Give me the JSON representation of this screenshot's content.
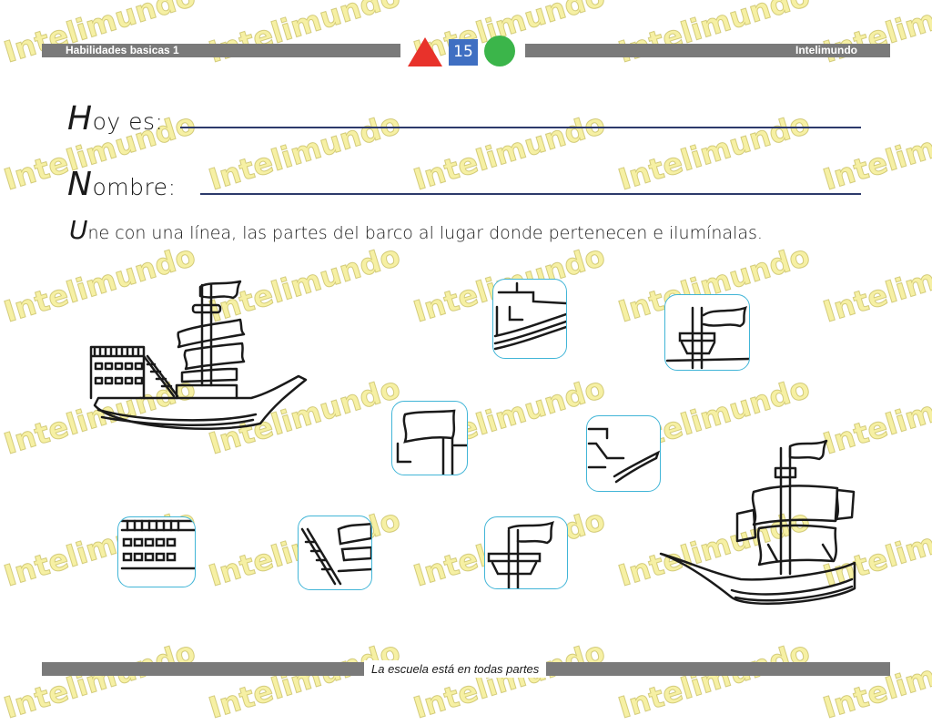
{
  "header": {
    "left_title": "Habilidades basicas 1",
    "page_number": "15",
    "right_title": "Intelimundo",
    "triangle_color": "#e8322b",
    "square_color": "#3f6fc2",
    "circle_color": "#3bb54a"
  },
  "form": {
    "date_cap": "H",
    "date_rest": "oy es:",
    "name_cap": "N",
    "name_rest": "ombre:"
  },
  "instruction": {
    "cap": "U",
    "rest": "ne con una línea, las partes del  barco al lugar donde pertenecen e ilumínalas."
  },
  "footer": {
    "text": "La escuela está en todas partes"
  },
  "watermark": {
    "text": "Intelimundo"
  }
}
